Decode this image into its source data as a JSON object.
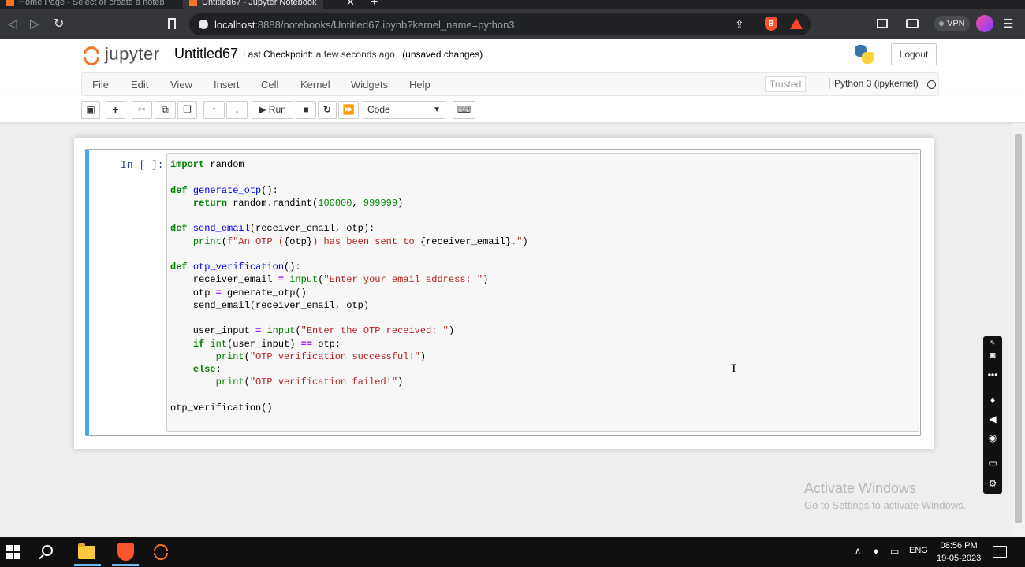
{
  "browser": {
    "tabs": [
      {
        "label": "Home Page - Select or create a noteb",
        "active": false
      },
      {
        "label": "Untitled67 - Jupyter Notebook",
        "active": true
      }
    ],
    "close_glyph": "✕",
    "new_tab_glyph": "+",
    "url_host": "localhost",
    "url_rest": ":8888/notebooks/Untitled67.ipynb?kernel_name=python3",
    "vpn_label": "VPN",
    "icons": [
      "back-arrow",
      "forward-arrow",
      "reload",
      "bookmark",
      "site-info",
      "share",
      "brave-shields",
      "brave-rewards",
      "sidebar",
      "wallet",
      "vpn",
      "profile",
      "menu"
    ]
  },
  "jupyter": {
    "logo_text": "jupyter",
    "notebook_name": "Untitled67",
    "checkpoint_label": "Last Checkpoint:",
    "checkpoint_time": "a few seconds ago",
    "unsaved": "(unsaved changes)",
    "logout_label": "Logout",
    "menu": [
      "File",
      "Edit",
      "View",
      "Insert",
      "Cell",
      "Kernel",
      "Widgets",
      "Help"
    ],
    "trusted_label": "Trusted",
    "kernel_label": "Python 3 (ipykernel)",
    "toolbar": {
      "run_label": "Run",
      "cell_type": "Code",
      "icons": [
        "save-icon",
        "add-icon",
        "cut-icon",
        "copy-icon",
        "paste-icon",
        "move-up-icon",
        "move-down-icon",
        "run-icon",
        "stop-icon",
        "restart-icon",
        "fast-forward-icon",
        "keyboard-icon"
      ]
    },
    "accent_color": "#42a5f5",
    "logo_color": "#f37726"
  },
  "cell": {
    "prompt": "In [ ]:",
    "lines": [
      "import random",
      "",
      "def generate_otp():",
      "    return random.randint(100000, 999999)",
      "",
      "def send_email(receiver_email, otp):",
      "    print(f\"An OTP ({otp}) has been sent to {receiver_email}.\")",
      "",
      "def otp_verification():",
      "    receiver_email = input(\"Enter your email address: \")",
      "    otp = generate_otp()",
      "    send_email(receiver_email, otp)",
      "",
      "    user_input = input(\"Enter the OTP received: \")",
      "    if int(user_input) == otp:",
      "        print(\"OTP verification successful!\")",
      "    else:",
      "        print(\"OTP verification failed!\")",
      "",
      "otp_verification()"
    ]
  },
  "watermark": {
    "title": "Activate Windows",
    "subtitle": "Go to Settings to activate Windows."
  },
  "taskbar": {
    "language": "ENG",
    "time": "08:56 PM",
    "date": "19-05-2023"
  }
}
